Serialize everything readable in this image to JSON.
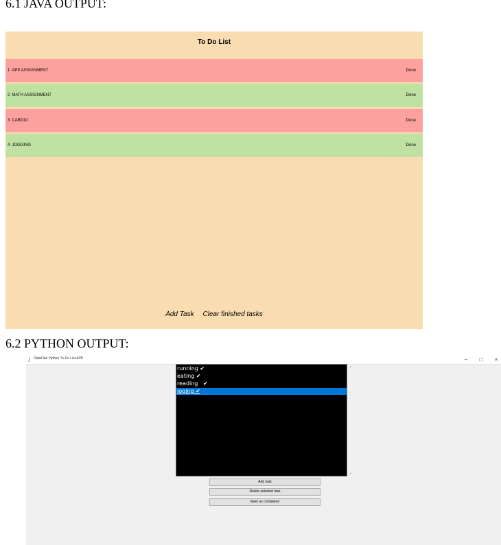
{
  "headings": {
    "java": "6.1 JAVA OUTPUT:",
    "python": "6.2 PYTHON OUTPUT:"
  },
  "java_app": {
    "title": "To Do List",
    "tasks": [
      {
        "number": "1",
        "name": "APP ASSIGNMENT",
        "action": "Done",
        "color": "#fca19d"
      },
      {
        "number": "2",
        "name": "MATH ASSIGNMENT",
        "action": "Done",
        "color": "#bfe1a2"
      },
      {
        "number": "3",
        "name": "CARDIO",
        "action": "Done",
        "color": "#fca19d"
      },
      {
        "number": "4",
        "name": "JOGGING",
        "action": "Done",
        "color": "#bfe1a2"
      }
    ],
    "add_task_label": "Add Task",
    "clear_label": "Clear finished tasks",
    "background_color": "#f9dcb0"
  },
  "python_app": {
    "window_title": "DataFlair Python To-Do List APP",
    "controls": {
      "minimize": "–",
      "maximize": "□",
      "close": "×"
    },
    "tasks": [
      {
        "text": "running ✔",
        "selected": false
      },
      {
        "text": "eating ✔",
        "selected": false
      },
      {
        "text": "reading   ✔",
        "selected": false
      },
      {
        "text": "joging ✔",
        "selected": true
      }
    ],
    "buttons": {
      "add": "Add task",
      "delete": "Delete selected task",
      "mark": "Mark as completed"
    },
    "listbox_background": "#000000",
    "selection_color": "#0078d7"
  }
}
